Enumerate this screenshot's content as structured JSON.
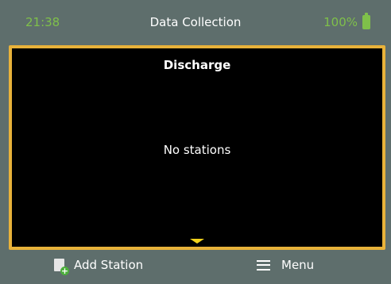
{
  "status_bar": {
    "time": "21:38",
    "title": "Data Collection",
    "battery": "100%"
  },
  "panel": {
    "title": "Discharge",
    "empty_message": "No stations"
  },
  "softkeys": {
    "left_label": "Add Station",
    "right_label": "Menu"
  },
  "icons": {
    "battery": "battery-icon",
    "scroll_down": "chevron-down-icon",
    "add_station": "add-station-icon",
    "menu": "hamburger-menu-icon"
  },
  "colors": {
    "background": "#5e6e6c",
    "accent_green": "#7fc04a",
    "panel_border": "#e8b23a",
    "scroll_indicator": "#f2d21c"
  }
}
